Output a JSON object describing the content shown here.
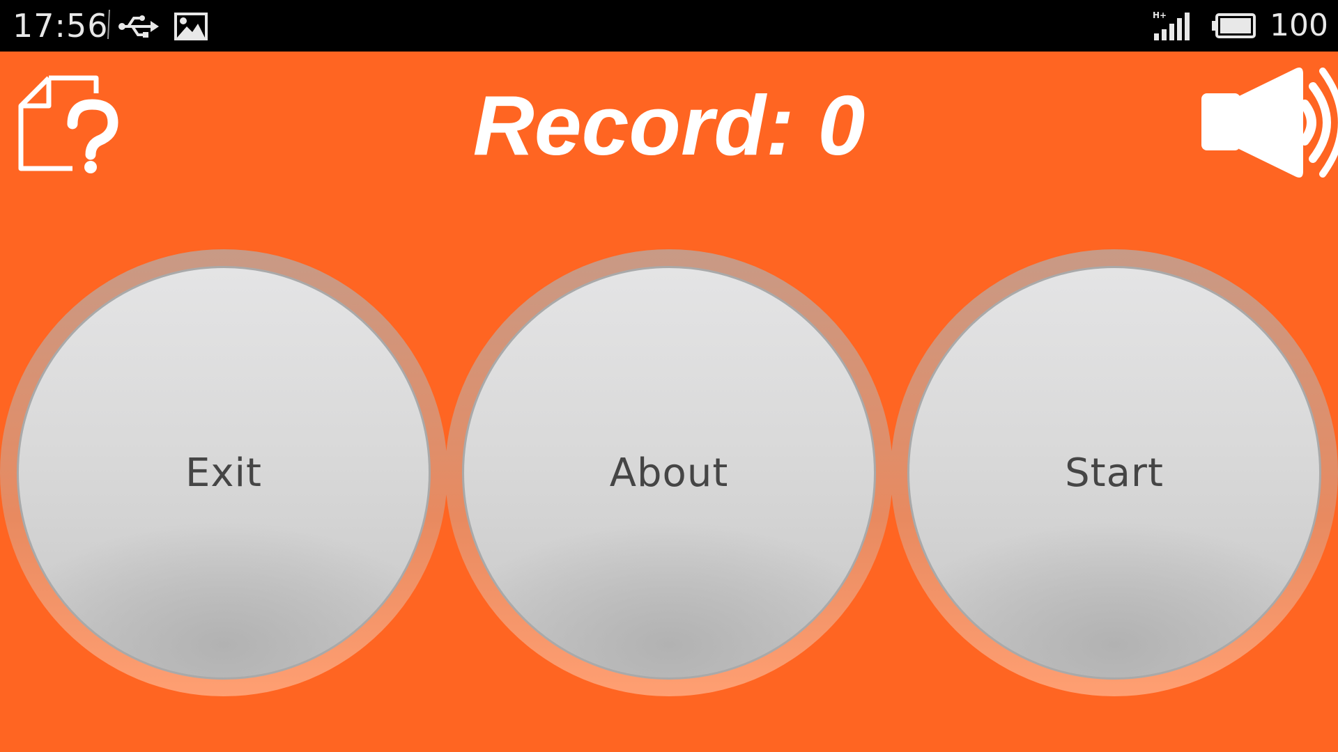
{
  "status_bar": {
    "time": "17:56",
    "battery_level": "100",
    "icons": [
      "usb-icon",
      "image-icon",
      "signal-hplus-icon",
      "battery-icon"
    ]
  },
  "header": {
    "record_label": "Record:",
    "record_value": "0",
    "icons": [
      "help-document-icon",
      "sound-on-icon"
    ]
  },
  "buttons": {
    "exit_label": "Exit",
    "about_label": "About",
    "start_label": "Start"
  },
  "colors": {
    "background": "#ff6522",
    "status_bar": "#000000",
    "button_face": "#d9d9d9",
    "button_text": "#454545",
    "title_text": "#ffffff"
  }
}
